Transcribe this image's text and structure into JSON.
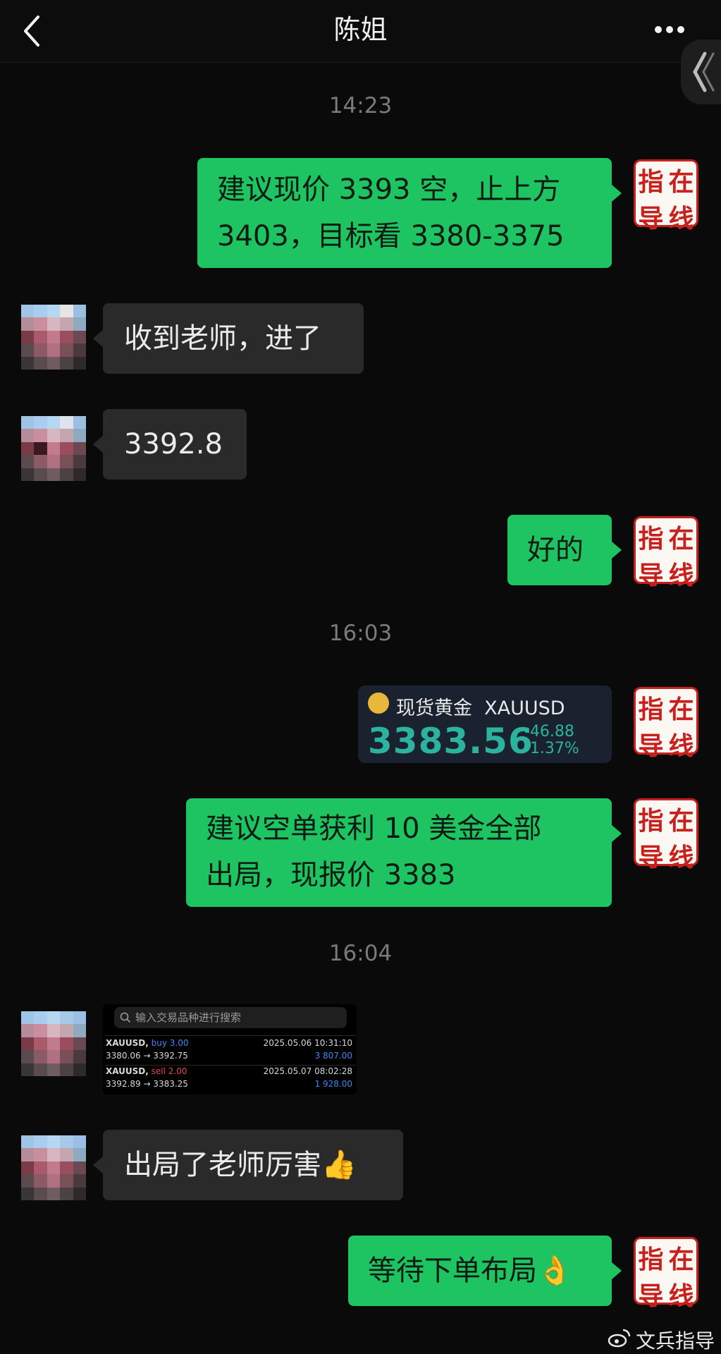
{
  "header": {
    "title": "陈姐",
    "back_icon": "chevron-left-icon",
    "more_icon": "more-dots-icon"
  },
  "messages": {
    "time1": "14:23",
    "msg1_line1": "建议现价 3393 空，止上方",
    "msg1_line2": "3403，目标看 3380-3375",
    "msg2": "收到老师，进了",
    "msg3": "3392.8",
    "msg4": "好的",
    "time2": "16:03",
    "msg5_line1": "建议空单获利 10 美金全部",
    "msg5_line2": "出局，现报价 3383",
    "time3": "16:04",
    "msg6": "出局了老师厉害👍",
    "msg7": "等待下单布局👌"
  },
  "seal": {
    "c1": "指",
    "c2": "在",
    "c3": "导",
    "c4": "线"
  },
  "gold_card": {
    "name": "现货黄金",
    "symbol": "XAUUSD",
    "price": "3383.56",
    "change": "-46.88",
    "change_pct": "-1.37%"
  },
  "trades": {
    "search_placeholder": "输入交易品种进行搜索",
    "rows": [
      {
        "symbol": "XAUUSD,",
        "side": "buy 3.00",
        "date": "2025.05.06 10:31:10",
        "prices": "3380.06 → 3392.75",
        "profit": "3 807.00"
      },
      {
        "symbol": "XAUUSD,",
        "side": "sell 2.00",
        "date": "2025.05.07 08:02:28",
        "prices": "3392.89 → 3383.25",
        "profit": "1 928.00"
      }
    ]
  },
  "watermark": "文兵指导",
  "colors": {
    "bubble_mine": "#1ec362",
    "bubble_theirs": "#2a2a2a",
    "seal_red": "#c8201c",
    "price_green": "#2bb3a0"
  }
}
